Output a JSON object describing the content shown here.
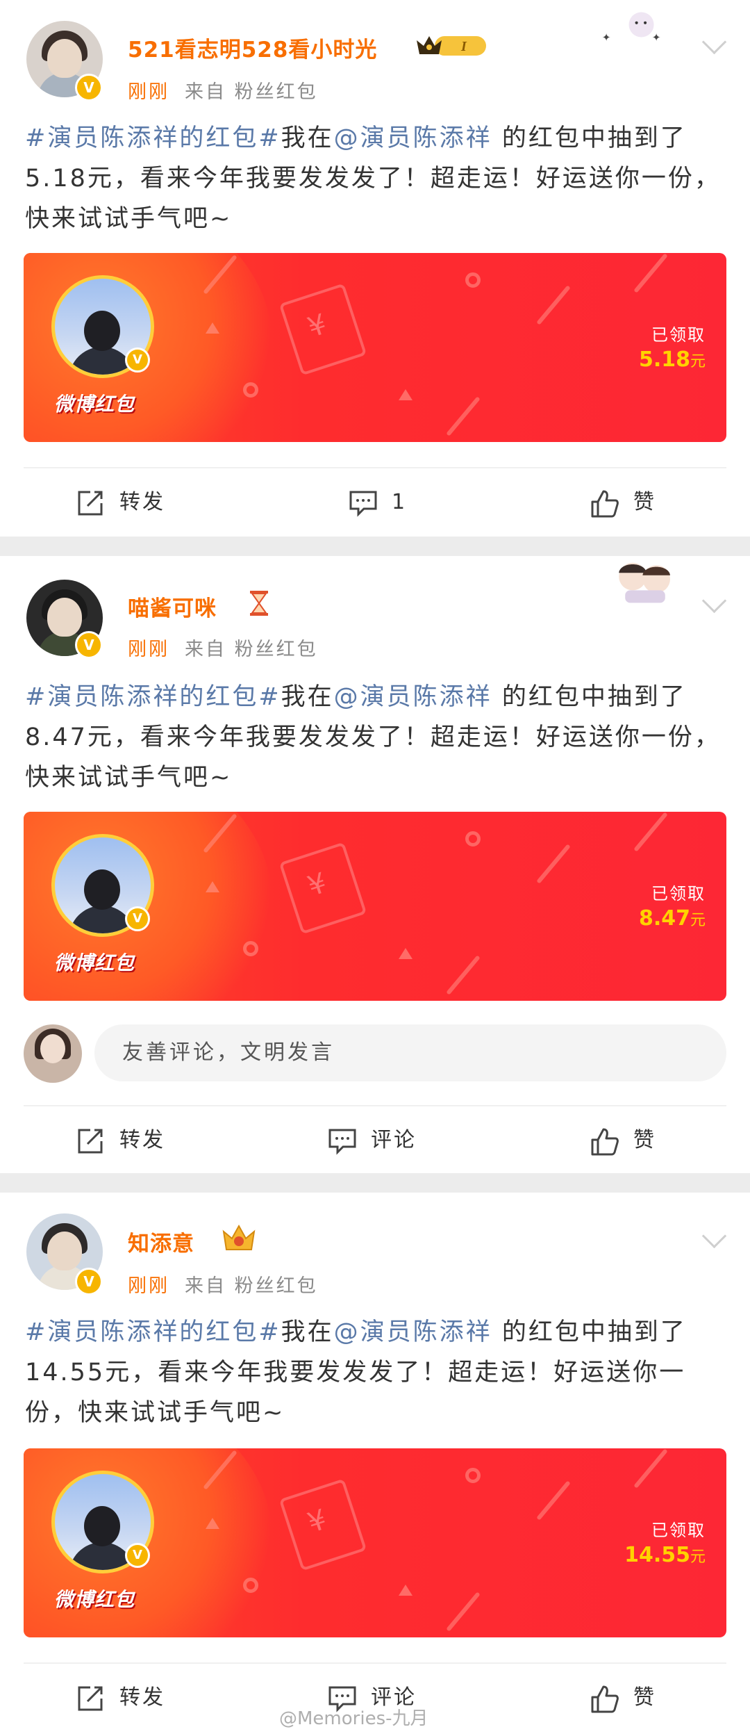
{
  "posts": [
    {
      "username": "521看志明528看小时光",
      "time": "刚刚",
      "source": "来自 粉丝红包",
      "tag": "#演员陈添祥的红包#",
      "text_mid": "我在",
      "mention": "@演员陈添祥",
      "text_rest": " 的红包中抽到了5.18元，看来今年我要发发发了！超走运！好运送你一份，快来试试手气吧~",
      "packet_brand": "微博红包",
      "packet_label": "已领取",
      "packet_amount": "5.18",
      "packet_unit": "元",
      "repost": "转发",
      "comment": "1",
      "like": "赞"
    },
    {
      "username": "喵酱可咪",
      "time": "刚刚",
      "source": "来自 粉丝红包",
      "tag": "#演员陈添祥的红包#",
      "text_mid": "我在",
      "mention": "@演员陈添祥",
      "text_rest": " 的红包中抽到了8.47元，看来今年我要发发发了！超走运！好运送你一份，快来试试手气吧~",
      "packet_brand": "微博红包",
      "packet_label": "已领取",
      "packet_amount": "8.47",
      "packet_unit": "元",
      "comment_placeholder": "友善评论，文明发言",
      "repost": "转发",
      "comment": "评论",
      "like": "赞"
    },
    {
      "username": "知添意",
      "time": "刚刚",
      "source": "来自 粉丝红包",
      "tag": "#演员陈添祥的红包#",
      "text_mid": "我在",
      "mention": "@演员陈添祥",
      "text_rest": " 的红包中抽到了14.55元，看来今年我要发发发了！超走运！好运送你一份，快来试试手气吧~",
      "packet_brand": "微博红包",
      "packet_label": "已领取",
      "packet_amount": "14.55",
      "packet_unit": "元",
      "repost": "转发",
      "comment": "评论",
      "like": "赞"
    }
  ],
  "watermark": "@Memories-九月",
  "icons": {
    "repost": "repost-icon",
    "comment": "comment-icon",
    "like": "thumbs-up-icon",
    "menu": "chevron-down-icon",
    "verified": "verified-badge-icon",
    "level_badge": "crown-level-badge-icon",
    "hourglass": "hourglass-icon"
  },
  "colors": {
    "username": "#f86e00",
    "tag": "#5a79a8",
    "packet": "#fe2c2e",
    "packet_amount": "#ffd200",
    "separator": "#ececec"
  }
}
